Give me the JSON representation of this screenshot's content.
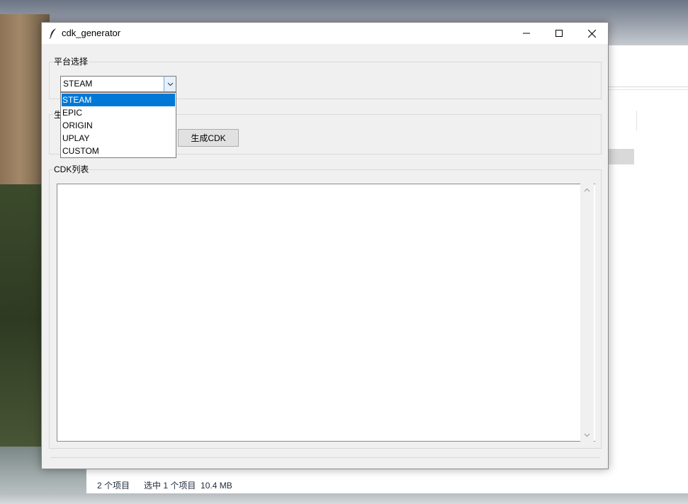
{
  "app": {
    "title": "cdk_generator",
    "title_icon": "feather-icon"
  },
  "titlebar_buttons": {
    "minimize_icon": "minimize-icon",
    "maximize_icon": "maximize-icon",
    "close_icon": "close-icon"
  },
  "platform_group": {
    "label": "平台选择",
    "selected_value": "STEAM",
    "options": [
      "STEAM",
      "EPIC",
      "ORIGIN",
      "UPLAY",
      "CUSTOM"
    ],
    "selected_index": 0
  },
  "generate_group": {
    "label_visible": "生",
    "button_label": "生成CDK"
  },
  "cdk_list_group": {
    "label": "CDK列表",
    "content": ""
  },
  "explorer_status": {
    "items": "2 个项目",
    "selection": "选中 1 个项目  10.4 MB"
  },
  "colors": {
    "selection_highlight": "#0078d7",
    "window_bg": "#f0f0f0",
    "titlebar_bg": "#ffffff"
  }
}
